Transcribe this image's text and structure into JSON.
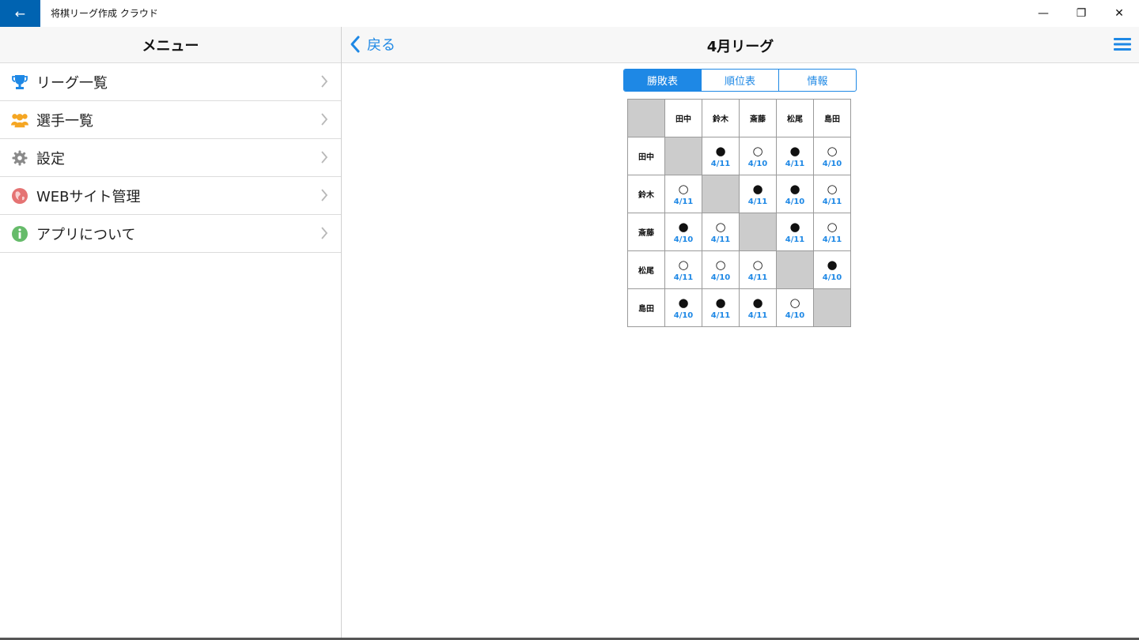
{
  "titlebar": {
    "app_title": "将棋リーグ作成 クラウド",
    "back_glyph": "←",
    "minimize_glyph": "—",
    "restore_glyph": "❐",
    "close_glyph": "✕"
  },
  "sidebar": {
    "title": "メニュー",
    "items": [
      {
        "label": "リーグ一覧",
        "icon": "trophy-icon",
        "color": "#1e88e5"
      },
      {
        "label": "選手一覧",
        "icon": "users-icon",
        "color": "#f5a623"
      },
      {
        "label": "設定",
        "icon": "gear-icon",
        "color": "#8a8a8a"
      },
      {
        "label": "WEBサイト管理",
        "icon": "globe-icon",
        "color": "#e57373"
      },
      {
        "label": "アプリについて",
        "icon": "info-icon",
        "color": "#66bb6a"
      }
    ]
  },
  "header": {
    "back_label": "戻る",
    "title": "4月リーグ"
  },
  "tabs": [
    {
      "label": "勝敗表",
      "active": true
    },
    {
      "label": "順位表",
      "active": false
    },
    {
      "label": "情報",
      "active": false
    }
  ],
  "table": {
    "players": [
      "田中",
      "鈴木",
      "斎藤",
      "松尾",
      "島田"
    ],
    "results": [
      [
        null,
        {
          "mark": "●",
          "date": "4/11"
        },
        {
          "mark": "○",
          "date": "4/10"
        },
        {
          "mark": "●",
          "date": "4/11"
        },
        {
          "mark": "○",
          "date": "4/10"
        }
      ],
      [
        {
          "mark": "○",
          "date": "4/11"
        },
        null,
        {
          "mark": "●",
          "date": "4/11"
        },
        {
          "mark": "●",
          "date": "4/10"
        },
        {
          "mark": "○",
          "date": "4/11"
        }
      ],
      [
        {
          "mark": "●",
          "date": "4/10"
        },
        {
          "mark": "○",
          "date": "4/11"
        },
        null,
        {
          "mark": "●",
          "date": "4/11"
        },
        {
          "mark": "○",
          "date": "4/11"
        }
      ],
      [
        {
          "mark": "○",
          "date": "4/11"
        },
        {
          "mark": "○",
          "date": "4/10"
        },
        {
          "mark": "○",
          "date": "4/11"
        },
        null,
        {
          "mark": "●",
          "date": "4/10"
        }
      ],
      [
        {
          "mark": "●",
          "date": "4/10"
        },
        {
          "mark": "●",
          "date": "4/11"
        },
        {
          "mark": "●",
          "date": "4/11"
        },
        {
          "mark": "○",
          "date": "4/10"
        },
        null
      ]
    ]
  },
  "colors": {
    "accent": "#1e88e5",
    "titlebar_back": "#0063b1",
    "diagonal": "#cccccc"
  }
}
